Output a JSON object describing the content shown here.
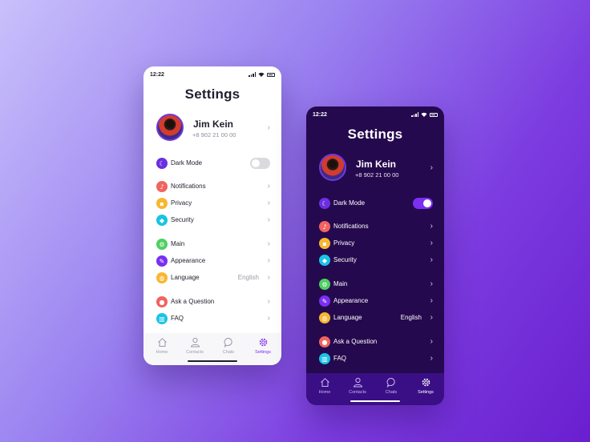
{
  "colors": {
    "accent": "#7b2ff2",
    "dark_bg": "#25094e",
    "dark_tabbar": "#3a0f86",
    "icon_dark_mode": "#6c2fe0",
    "icon_notifications": "#f2635f",
    "icon_privacy": "#f7b731",
    "icon_security": "#19c3e6",
    "icon_main": "#4fcf63",
    "icon_appearance": "#7b2ff2",
    "icon_language": "#f7b731",
    "icon_ask": "#f2635f",
    "icon_faq": "#19c3e6"
  },
  "light": {
    "status_time": "12:22",
    "title": "Settings",
    "profile": {
      "name": "Jim Kein",
      "phone": "+8 902 21 00 00"
    },
    "dark_mode": {
      "label": "Dark Mode",
      "enabled": false
    },
    "items": {
      "notifications": "Notifications",
      "privacy": "Privacy",
      "security": "Security",
      "main": "Main",
      "appearance": "Appearance",
      "language": "Language",
      "language_value": "English",
      "ask": "Ask a Question",
      "faq": "FAQ"
    },
    "tabs": {
      "home": "Home",
      "contacts": "Contacts",
      "chats": "Chats",
      "settings": "Settings"
    }
  },
  "dark": {
    "status_time": "12:22",
    "title": "Settings",
    "profile": {
      "name": "Jim Kein",
      "phone": "+8 902 21 00 00"
    },
    "dark_mode": {
      "label": "Dark Mode",
      "enabled": true
    },
    "items": {
      "notifications": "Notifications",
      "privacy": "Privacy",
      "security": "Security",
      "main": "Main",
      "appearance": "Appearance",
      "language": "Language",
      "language_value": "English",
      "ask": "Ask a Question",
      "faq": "FAQ"
    },
    "tabs": {
      "home": "Home",
      "contacts": "Contacts",
      "chats": "Chats",
      "settings": "Settings"
    }
  },
  "icons": {
    "dark_mode": "moon-icon",
    "notifications": "bell-icon",
    "privacy": "lock-icon",
    "security": "shield-icon",
    "main": "gear-icon",
    "appearance": "paint-icon",
    "language": "globe-icon",
    "ask": "chat-bubble-icon",
    "faq": "book-icon"
  }
}
